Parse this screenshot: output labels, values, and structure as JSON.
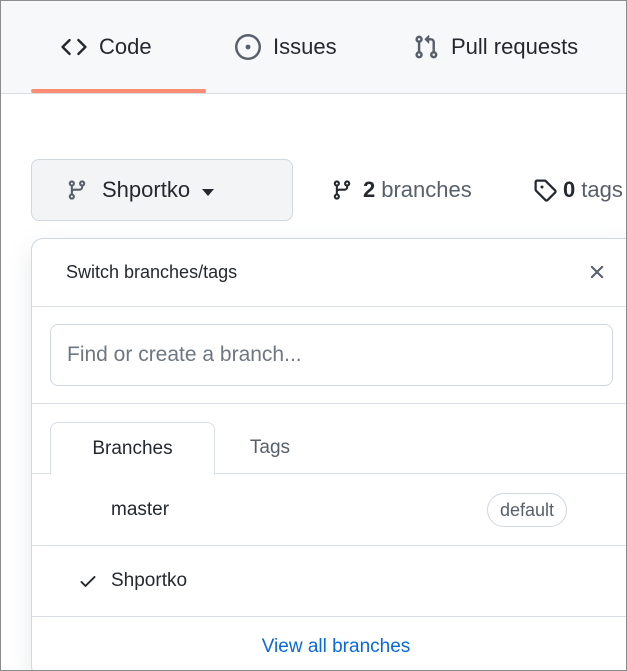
{
  "nav": {
    "tabs": [
      {
        "label": "Code",
        "icon": "code-icon",
        "selected": true
      },
      {
        "label": "Issues",
        "icon": "issue-opened-icon"
      },
      {
        "label": "Pull requests",
        "icon": "git-pull-request-icon"
      }
    ],
    "accent_color": "#fd8c73"
  },
  "branch_selector": {
    "current": "Shportko",
    "icon": "git-branch-icon"
  },
  "repo_stats": {
    "branches_count": "2",
    "branches_label": "branches",
    "tags_count": "0",
    "tags_label": "tags"
  },
  "dropdown": {
    "title": "Switch branches/tags",
    "filter_placeholder": "Find or create a branch...",
    "tabs": [
      {
        "label": "Branches",
        "selected": true
      },
      {
        "label": "Tags"
      }
    ],
    "branches": [
      {
        "name": "master",
        "badge": "default",
        "checked": false
      },
      {
        "name": "Shportko",
        "badge": "",
        "checked": true
      }
    ],
    "footer_link": "View all branches",
    "link_color": "#0969da"
  }
}
